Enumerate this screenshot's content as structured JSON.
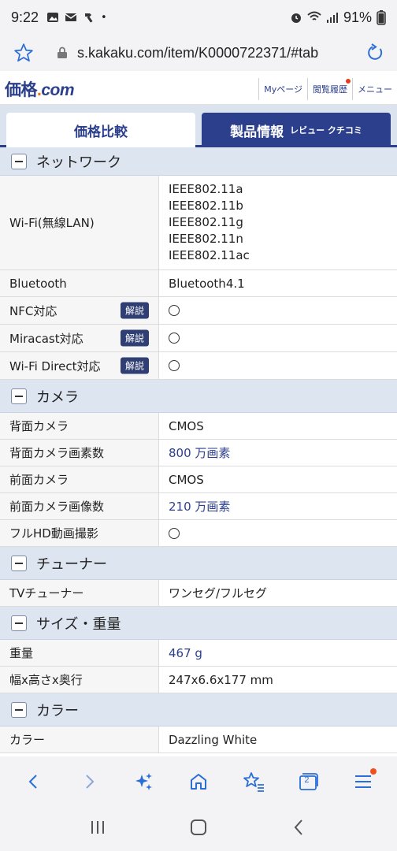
{
  "status": {
    "time": "9:22",
    "battery": "91%"
  },
  "browser": {
    "url": "s.kakaku.com/item/K0000722371/#tab"
  },
  "site": {
    "logo_main": "価格",
    "logo_dot": ".",
    "logo_com": "com",
    "links": [
      "Myページ",
      "閲覧履歴",
      "メニュー"
    ]
  },
  "tabs": {
    "price": "価格比較",
    "product": "製品情報",
    "product_sub": "レビュー クチコミ"
  },
  "sections": {
    "network": {
      "title": "ネットワーク",
      "wifi_label": "Wi-Fi(無線LAN)",
      "wifi_values": [
        "IEEE802.11a",
        "IEEE802.11b",
        "IEEE802.11g",
        "IEEE802.11n",
        "IEEE802.11ac"
      ],
      "bt_label": "Bluetooth",
      "bt_value": "Bluetooth4.1",
      "nfc_label": "NFC対応",
      "miracast_label": "Miracast対応",
      "wifidirect_label": "Wi-Fi Direct対応",
      "badge": "解説"
    },
    "camera": {
      "title": "カメラ",
      "rear_label": "背面カメラ",
      "rear_value": "CMOS",
      "rear_px_label": "背面カメラ画素数",
      "rear_px_value": "800 万画素",
      "front_label": "前面カメラ",
      "front_value": "CMOS",
      "front_px_label": "前面カメラ画像数",
      "front_px_value": "210 万画素",
      "fullhd_label": "フルHD動画撮影"
    },
    "tuner": {
      "title": "チューナー",
      "tv_label": "TVチューナー",
      "tv_value": "ワンセグ/フルセグ"
    },
    "size": {
      "title": "サイズ・重量",
      "weight_label": "重量",
      "weight_value": "467 g",
      "dims_label": "幅x高さx奥行",
      "dims_value": "247x6.6x177 mm"
    },
    "color": {
      "title": "カラー",
      "color_label": "カラー",
      "color_value": "Dazzling White"
    }
  },
  "bottom_nav": {
    "tab_count": "2"
  }
}
